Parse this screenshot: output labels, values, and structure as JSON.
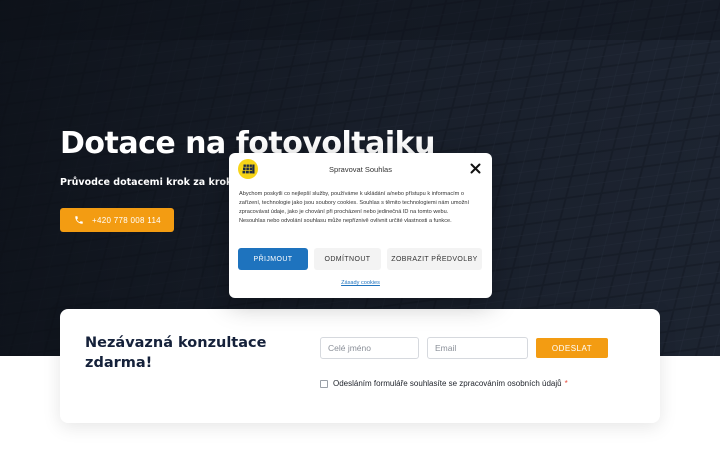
{
  "hero": {
    "title": "Dotace na fotovoltaiku",
    "subtitle": "Průvodce dotacemi krok za krokem – jed",
    "phone_label": "+420 778 008 114"
  },
  "form": {
    "title": "Nezávazná konzultace zdarma!",
    "name_placeholder": "Celé jméno",
    "email_placeholder": "Email",
    "submit_label": "ODESLAT",
    "consent_label": "Odesláním formuláře souhlasíte se zpracováním osobních údajů",
    "required_mark": "*"
  },
  "cookie_modal": {
    "title": "Spravovat Souhlas",
    "text": "Abychom poskytli co nejlepší služby, používáme k ukládání a/nebo přístupu k informacím o zařízení, technologie jako jsou soubory cookies. Souhlas s těmito technologiemi nám umožní zpracovávat údaje, jako je chování při procházení nebo jedinečná ID na tomto webu. Nesouhlas nebo odvolání souhlasu může nepříznivě ovlivnit určité vlastnosti a funkce.",
    "accept_label": "PŘIJMOUT",
    "deny_label": "ODMÍTNOUT",
    "prefs_label": "ZOBRAZIT PŘEDVOLBY",
    "policy_link": "Zásady cookies"
  },
  "colors": {
    "accent": "#f39c12",
    "primary_button": "#1e73be",
    "heading": "#15213a",
    "logo_yellow": "#f7d418"
  },
  "icons": {
    "phone": "phone-icon",
    "close": "close-icon",
    "logo": "solar-panel-logo-icon"
  }
}
